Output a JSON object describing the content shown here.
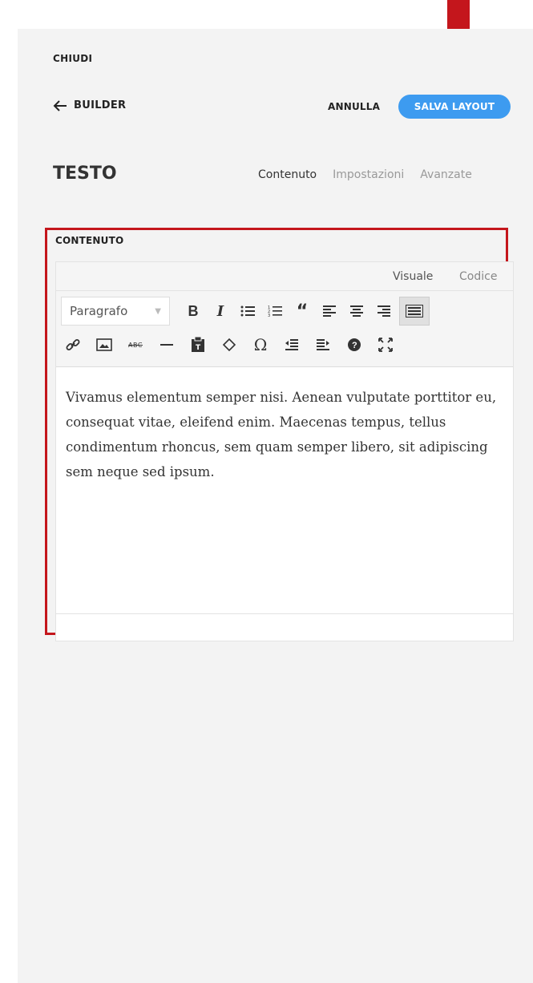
{
  "header": {
    "close_label": "CHIUDI",
    "back_label": "BUILDER",
    "cancel_label": "ANNULLA",
    "save_label": "SALVA LAYOUT"
  },
  "module": {
    "title": "TESTO",
    "tabs": [
      {
        "label": "Contenuto",
        "active": true
      },
      {
        "label": "Impostazioni",
        "active": false
      },
      {
        "label": "Avanzate",
        "active": false
      }
    ]
  },
  "content_section": {
    "label": "CONTENUTO",
    "modes": {
      "visual": "Visuale",
      "code": "Codice"
    },
    "format_value": "Paragrafo",
    "body_text": "Vivamus elementum semper nisi. Aenean vulputate porttitor eu, consequat vitae, eleifend enim. Maecenas tempus, tellus condimentum rhoncus,  sem quam semper libero, sit adipiscing sem neque sed ipsum."
  },
  "colors": {
    "accent": "#3d9bf0",
    "highlight": "#c4161c",
    "panel_bg": "#f3f3f3"
  }
}
